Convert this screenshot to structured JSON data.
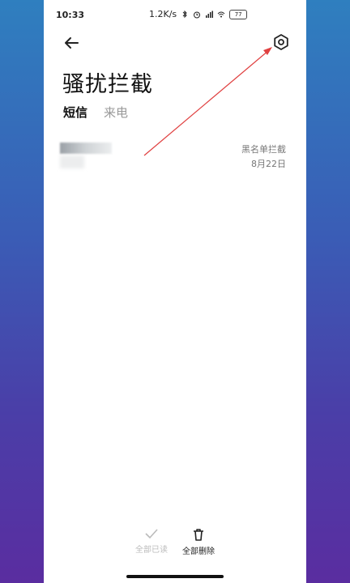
{
  "status_bar": {
    "time": "10:33",
    "speed": "1.2K/s",
    "battery": "77"
  },
  "header": {
    "title": "骚扰拦截"
  },
  "tabs": [
    {
      "label": "短信",
      "active": true
    },
    {
      "label": "来电",
      "active": false
    }
  ],
  "messages": [
    {
      "reason": "黑名单拦截",
      "date": "8月22日"
    }
  ],
  "bottom_actions": {
    "mark_read_label": "全部已读",
    "delete_label": "全部删除"
  },
  "colors": {
    "annotation_arrow": "#e04040"
  }
}
